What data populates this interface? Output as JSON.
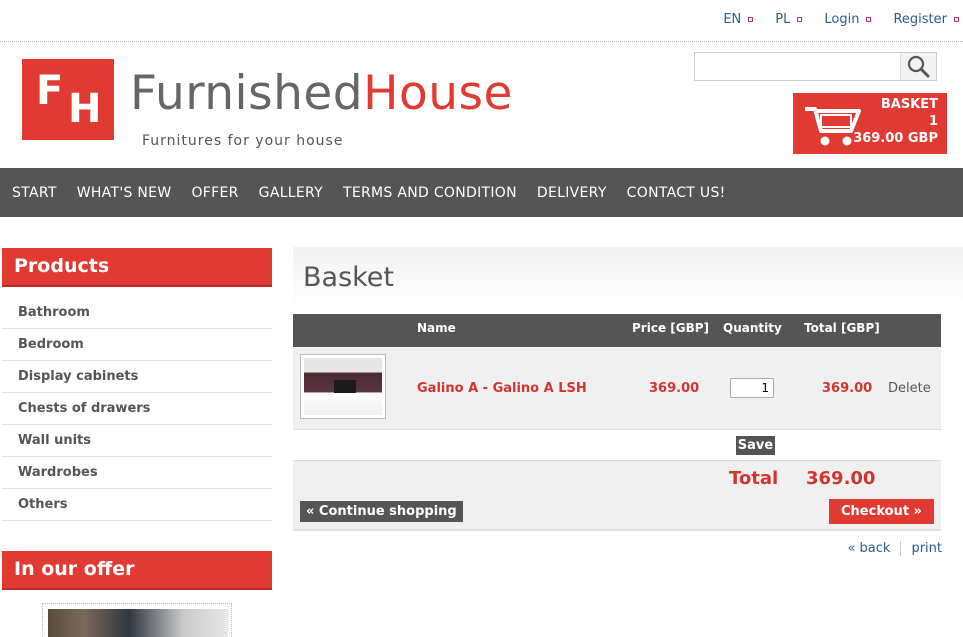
{
  "top_links": [
    {
      "label": "EN"
    },
    {
      "label": "PL"
    },
    {
      "label": "Login"
    },
    {
      "label": "Register"
    }
  ],
  "logo": {
    "mark_line1": "F",
    "mark_line2": "H",
    "name_part1": "Furnished",
    "name_part2": "House",
    "tagline": "Furnitures for your house"
  },
  "search": {
    "placeholder": "",
    "icon": "search-icon"
  },
  "basket": {
    "label": "BASKET",
    "count": "1",
    "total": "369.00 GBP",
    "icon": "cart-icon"
  },
  "nav": [
    {
      "label": "START"
    },
    {
      "label": "WHAT'S NEW"
    },
    {
      "label": "OFFER"
    },
    {
      "label": "GALLERY"
    },
    {
      "label": "TERMS AND CONDITION"
    },
    {
      "label": "DELIVERY"
    },
    {
      "label": "CONTACT US!"
    }
  ],
  "sidebar": {
    "products_title": "Products",
    "categories": [
      {
        "label": "Bathroom"
      },
      {
        "label": "Bedroom"
      },
      {
        "label": "Display cabinets"
      },
      {
        "label": "Chests of drawers"
      },
      {
        "label": "Wall units"
      },
      {
        "label": "Wardrobes"
      },
      {
        "label": "Others"
      }
    ],
    "offer_title": "In our offer"
  },
  "main": {
    "title": "Basket",
    "columns": {
      "name": "Name",
      "price": "Price [GBP]",
      "quantity": "Quantity",
      "total": "Total [GBP]"
    },
    "items": [
      {
        "name": "Galino A - Galino A LSH",
        "price": "369.00",
        "quantity": "1",
        "total": "369.00",
        "delete_label": "Delete"
      }
    ],
    "save_label": "Save",
    "total_label": "Total",
    "total_value": "369.00",
    "continue_label": "« Continue shopping",
    "checkout_label": "Checkout »",
    "back_label": "« back",
    "print_label": "print"
  },
  "colors": {
    "accent": "#e03a33",
    "nav_bg": "#555555",
    "link": "#2c5d8f"
  }
}
